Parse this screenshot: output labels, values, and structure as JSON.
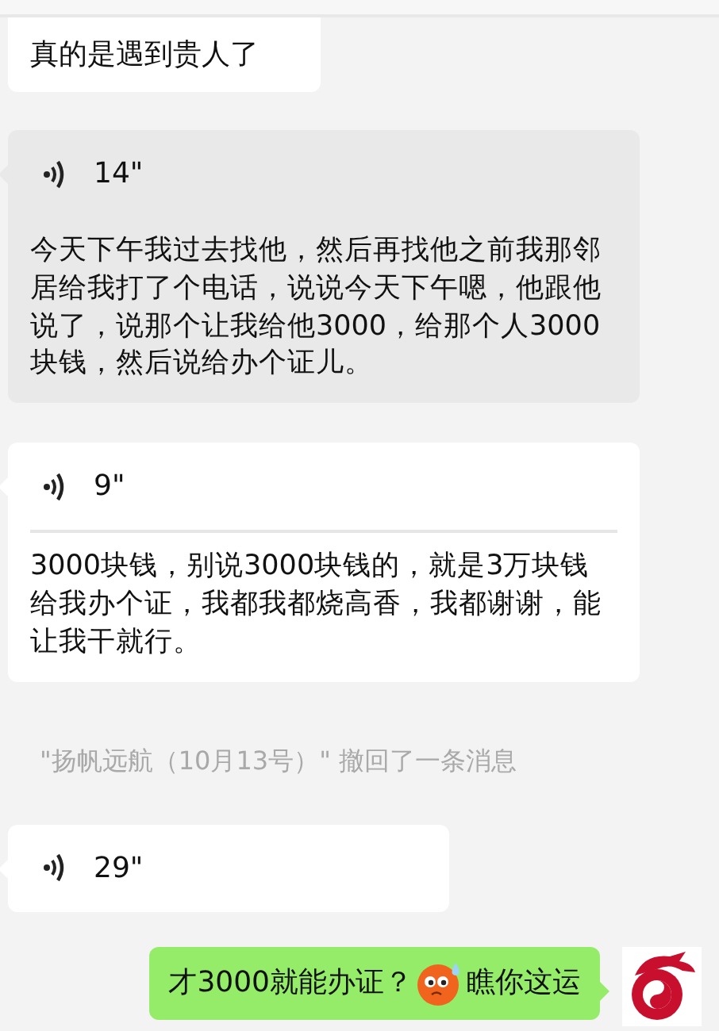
{
  "messages": [
    {
      "kind": "text",
      "text": "真的是遇到贵人了"
    },
    {
      "kind": "voice",
      "highlighted": true,
      "duration": "14\"",
      "transcript": "今天下午我过去找他，然后再找他之前我那邻居给我打了个电话，说说今天下午嗯，他跟他说了，说那个让我给他3000，给那个人3000块钱，然后说给办个证儿。"
    },
    {
      "kind": "voice",
      "highlighted": false,
      "duration": "9\"",
      "transcript": "3000块钱，别说3000块钱的，就是3万块钱给我办个证，我都我都烧高香，我都谢谢，能让我干就行。"
    },
    {
      "kind": "system",
      "text": "\"扬帆远航（10月13号）\" 撤回了一条消息"
    },
    {
      "kind": "voice",
      "highlighted": false,
      "duration": "29\""
    },
    {
      "kind": "outgoing",
      "segments": [
        {
          "kind": "text",
          "text": "才3000就能办证？"
        },
        {
          "kind": "emoji"
        },
        {
          "kind": "text",
          "text": "瞧你这运"
        }
      ]
    }
  ]
}
